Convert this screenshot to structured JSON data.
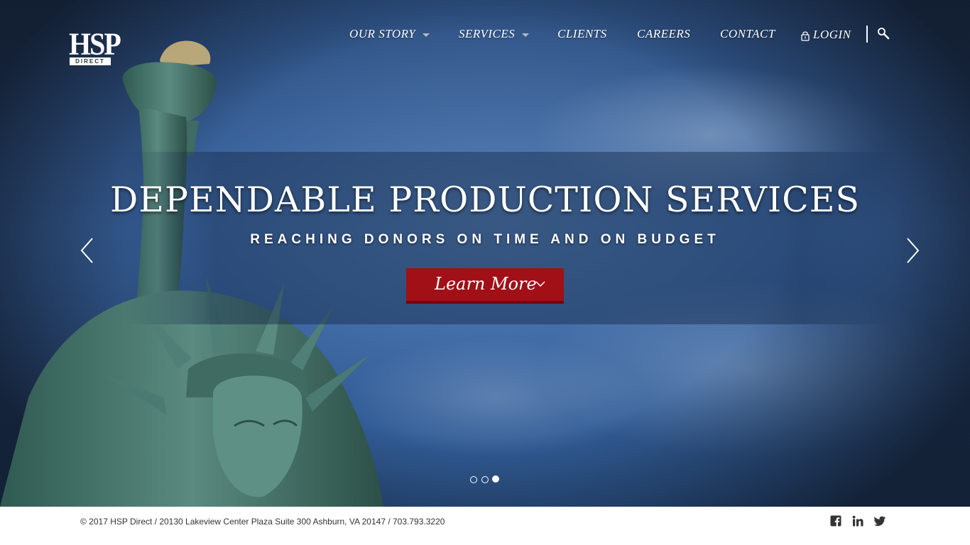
{
  "brand": {
    "logo_main": "HSP",
    "logo_sub": "DIRECT"
  },
  "nav": {
    "items": [
      {
        "label": "OUR STORY",
        "has_dropdown": true
      },
      {
        "label": "SERVICES",
        "has_dropdown": true
      },
      {
        "label": "CLIENTS",
        "has_dropdown": false
      },
      {
        "label": "CAREERS",
        "has_dropdown": false
      },
      {
        "label": "CONTACT",
        "has_dropdown": false
      }
    ],
    "login_label": "LOGIN",
    "login_icon": "lock-icon",
    "search_icon": "search-icon"
  },
  "hero": {
    "headline": "DEPENDABLE PRODUCTION SERVICES",
    "subheadline": "REACHING DONORS ON TIME AND ON BUDGET",
    "cta_label": "Learn More",
    "cta_icon": "chevron-down-icon",
    "prev_icon": "chevron-left-icon",
    "next_icon": "chevron-right-icon",
    "slide_count": 3,
    "active_slide": 3
  },
  "footer": {
    "copyright": "© 2017 HSP Direct / 20130 Lakeview Center Plaza Suite 300 Ashburn, VA 20147 / 703.793.3220",
    "social": [
      "facebook-icon",
      "linkedin-icon",
      "twitter-icon"
    ]
  },
  "colors": {
    "cta_red": "#a01016",
    "sky_blue": "#3b66a3",
    "statue_green": "#4a7a72",
    "text_white": "#ffffff"
  }
}
